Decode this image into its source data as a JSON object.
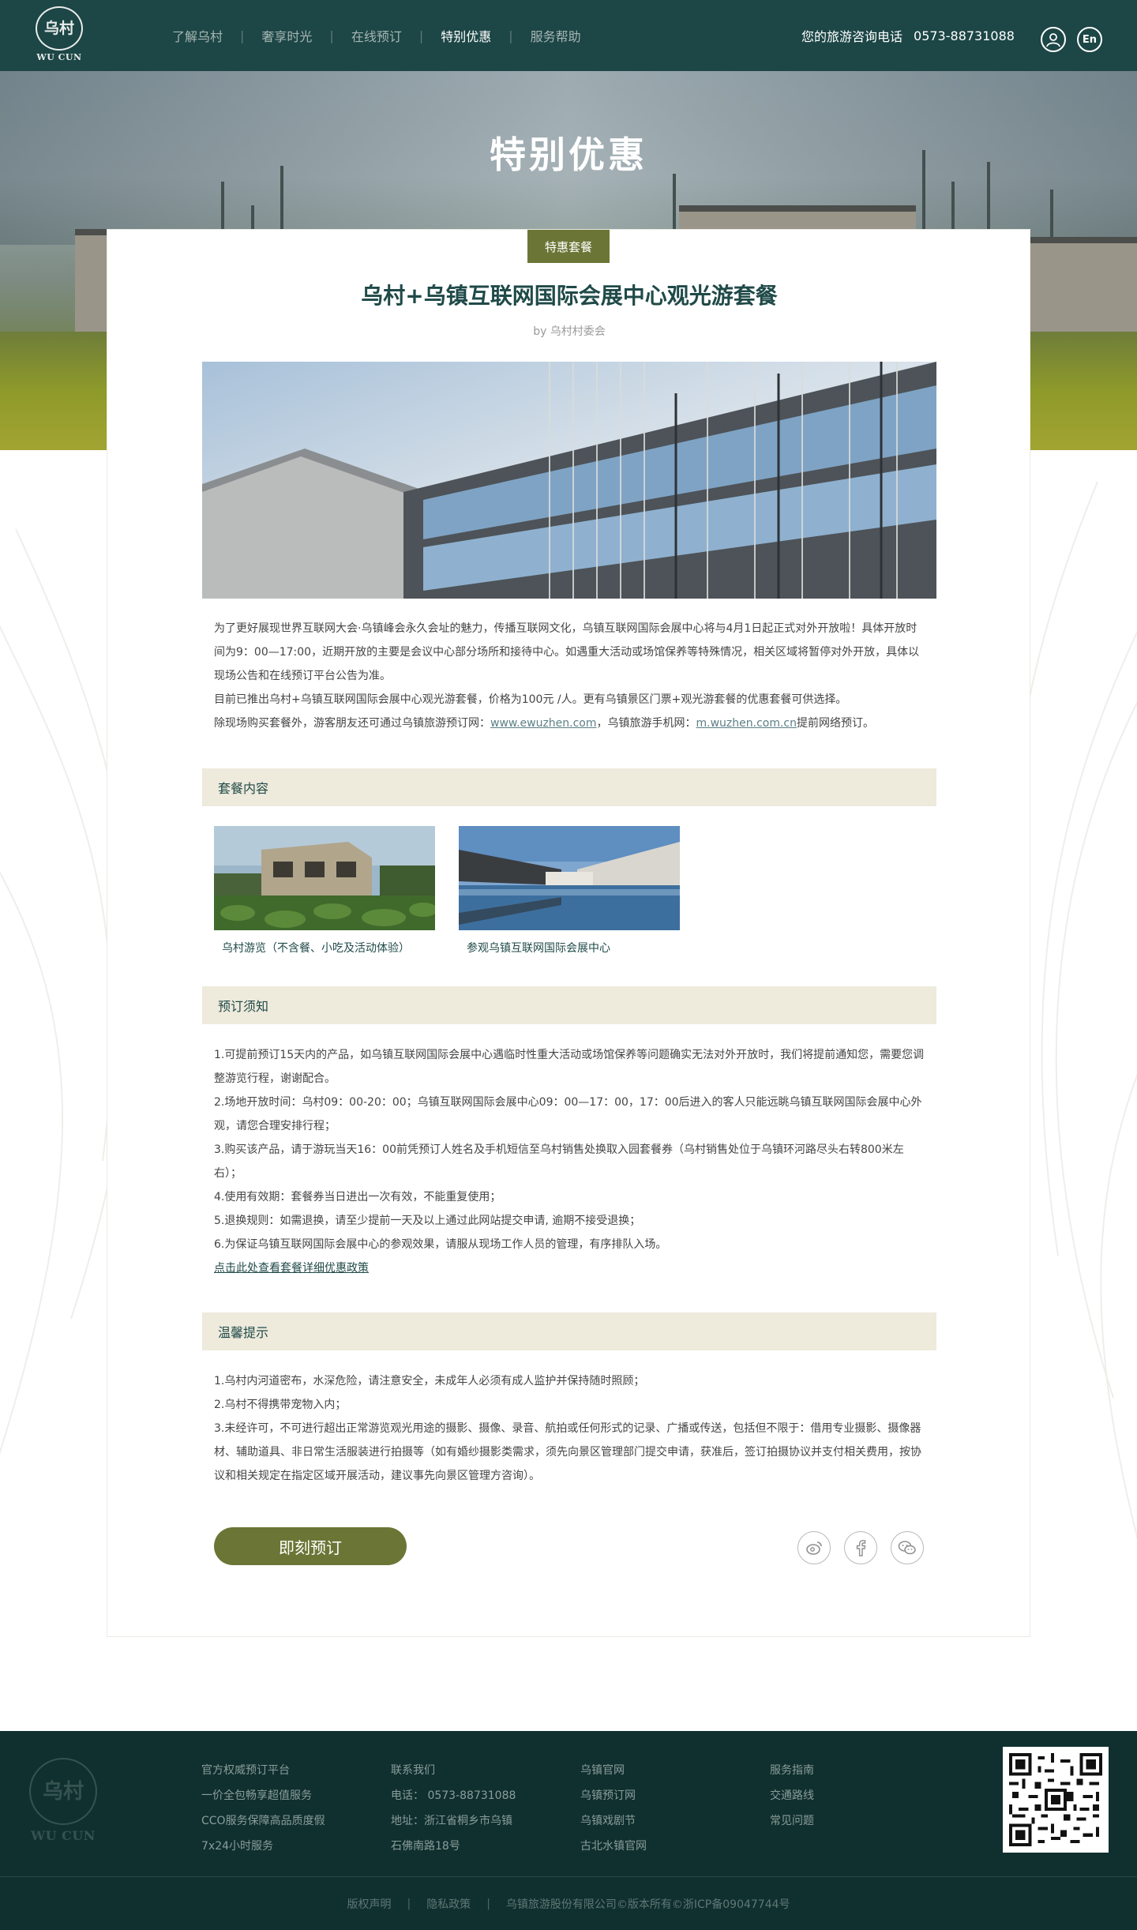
{
  "header": {
    "logo_main": "乌村",
    "logo_text": "WU CUN",
    "nav": [
      {
        "label": "了解乌村",
        "active": false
      },
      {
        "label": "奢享时光",
        "active": false
      },
      {
        "label": "在线预订",
        "active": false
      },
      {
        "label": "特别优惠",
        "active": true
      },
      {
        "label": "服务帮助",
        "active": false
      }
    ],
    "hotline_label": "您的旅游咨询电话",
    "hotline_number": "0573-88731088",
    "lang_label": "En"
  },
  "hero": {
    "title": "特别优惠"
  },
  "article": {
    "tag": "特惠套餐",
    "title": "乌村+乌镇互联网国际会展中心观光游套餐",
    "author": "by 乌村村委会",
    "intro": {
      "p1": "为了更好展现世界互联网大会·乌镇峰会永久会址的魅力，传播互联网文化，乌镇互联网国际会展中心将与4月1日起正式对外开放啦！具体开放时间为9：00—17:00，近期开放的主要是会议中心部分场所和接待中心。如遇重大活动或场馆保养等特殊情况，相关区域将暂停对外开放，具体以现场公告和在线预订平台公告为准。",
      "p2": "目前已推出乌村+乌镇互联网国际会展中心观光游套餐，价格为100元 /人。更有乌镇景区门票+观光游套餐的优惠套餐可供选择。",
      "p3_before": "除现场购买套餐外，游客朋友还可通过乌镇旅游预订网：",
      "p3_link1": "www.ewuzhen.com",
      "p3_middle": "，乌镇旅游手机网：",
      "p3_link2": "m.wuzhen.com.cn",
      "p3_after": "提前网络预订。"
    },
    "package_section": {
      "title": "套餐内容",
      "items": [
        {
          "label": "乌村游览（不含餐、小吃及活动体验）"
        },
        {
          "label": "参观乌镇互联网国际会展中心"
        }
      ]
    },
    "booking_section": {
      "title": "预订须知",
      "notes": [
        "1.可提前预订15天内的产品，如乌镇互联网国际会展中心遇临时性重大活动或场馆保养等问题确实无法对外开放时，我们将提前通知您，需要您调整游览行程，谢谢配合。",
        "2.场地开放时间：乌村09：00-20：00；乌镇互联网国际会展中心09：00—17：00，17：00后进入的客人只能远眺乌镇互联网国际会展中心外观，请您合理安排行程；",
        "3.购买该产品，请于游玩当天16：00前凭预订人姓名及手机短信至乌村销售处换取入园套餐券（乌村销售处位于乌镇环河路尽头右转800米左右）；",
        "4.使用有效期：套餐券当日进出一次有效，不能重复使用；",
        "5.退换规则：如需退换，请至少提前一天及以上通过此网站提交申请, 逾期不接受退换；",
        "6.为保证乌镇互联网国际会展中心的参观效果，请服从现场工作人员的管理，有序排队入场。"
      ],
      "policy_link": "点击此处查看套餐详细优惠政策"
    },
    "tips_section": {
      "title": "温馨提示",
      "notes": [
        "1.乌村内河道密布，水深危险，请注意安全，未成年人必须有成人监护并保持随时照顾；",
        "2.乌村不得携带宠物入内；",
        "3.未经许可，不可进行超出正常游览观光用途的摄影、摄像、录音、航拍或任何形式的记录、广播或传送，包括但不限于：借用专业摄影、摄像器材、辅助道具、非日常生活服装进行拍摄等（如有婚纱摄影类需求，须先向景区管理部门提交申请，获准后，签订拍摄协议并支付相关费用，按协议和相关规定在指定区域开展活动，建议事先向景区管理方咨询）。"
      ]
    },
    "book_button": "即刻预订",
    "share_icons": [
      "weibo-icon",
      "facebook-icon",
      "wechat-icon"
    ]
  },
  "footer": {
    "logo_main": "乌村",
    "logo_text": "WU CUN",
    "col1": [
      "官方权威预订平台",
      "一价全包畅享超值服务",
      "CCO服务保障高品质度假",
      "7x24小时服务"
    ],
    "col2": [
      "联系我们",
      "电话：  0573-88731088",
      "地址：浙江省桐乡市乌镇",
      "石佛南路18号"
    ],
    "col3": [
      "乌镇官网",
      "乌镇预订网",
      "乌镇戏剧节",
      "古北水镇官网"
    ],
    "col4": [
      "服务指南",
      "交通路线",
      "常见问题"
    ],
    "bottom": [
      "版权声明",
      "隐私政策",
      "乌镇旅游股份有限公司©版本所有©浙ICP备09047744号"
    ]
  },
  "colors": {
    "header_bg": "#1d4646",
    "accent_olive": "#6b7636",
    "section_bar": "#eeeadc",
    "title_teal": "#1f4a48",
    "footer_bg": "#10302f"
  }
}
